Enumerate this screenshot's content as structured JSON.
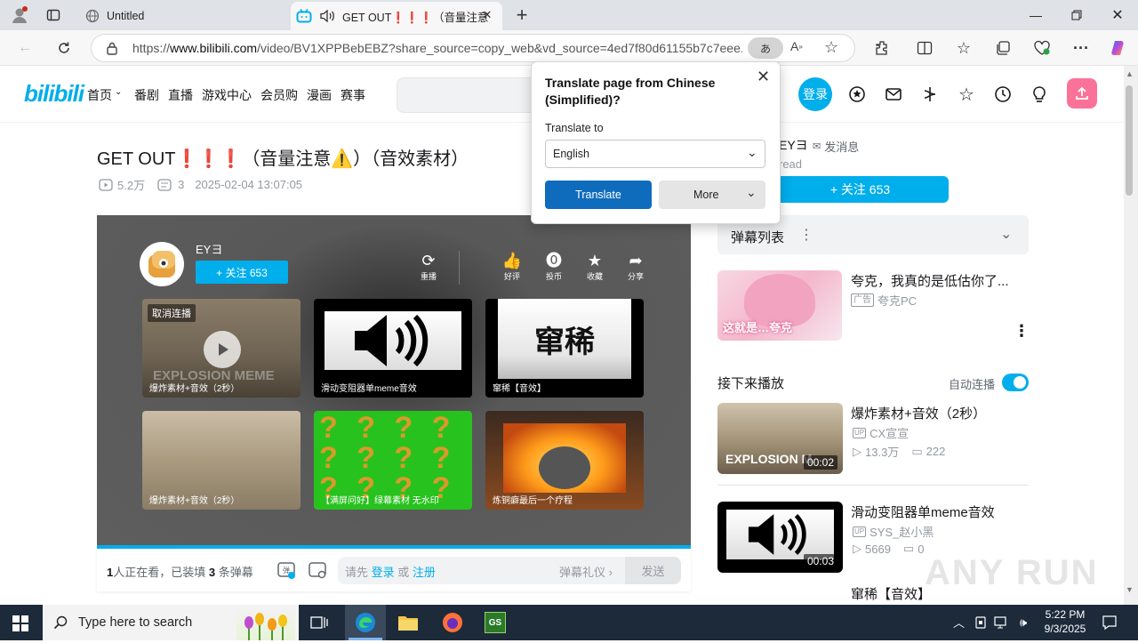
{
  "browser": {
    "tabs": [
      {
        "title": "Untitled",
        "active": false
      },
      {
        "title": "GET OUT❗❗❗（音量注意⚠️）",
        "active": true
      }
    ],
    "url_prefix": "https://",
    "url_host": "www.bilibili.com",
    "url_rest": "/video/BV1XPPBebEBZ?share_source=copy_web&vd_source=4ed7f80d61155b7c7eee...",
    "translate_icon_label": "あ"
  },
  "translate_popup": {
    "heading": "Translate page from Chinese (Simplified)?",
    "label": "Translate to",
    "language": "English",
    "translate_button": "Translate",
    "more_button": "More"
  },
  "site": {
    "logo": "bilibili",
    "nav": [
      "首页",
      "番剧",
      "直播",
      "游戏中心",
      "会员购",
      "漫画",
      "赛事"
    ],
    "login": "登录"
  },
  "video": {
    "title": "GET OUT❗❗❗（音量注意⚠️）（音效素材）",
    "views": "5.2万",
    "danmaku_count": "3",
    "date": "2025-02-04 13:07:05"
  },
  "endscreen": {
    "uploader": "EYヨ",
    "follow": "+ 关注 653",
    "replay": "重播",
    "actions": [
      "好评",
      "投币",
      "收藏",
      "分享"
    ],
    "cancel_autoplay": "取消连播",
    "items": [
      {
        "caption": "爆炸素材+音效（2秒）",
        "art": "EXPLOSION MEME"
      },
      {
        "caption": "滑动变阻器单meme音效",
        "art": ""
      },
      {
        "caption": "窜稀【音效】",
        "art": "窜稀"
      },
      {
        "caption": "爆炸素材+音效（2秒）",
        "art": ""
      },
      {
        "caption": "【满屏问好】绿幕素材 无水印",
        "art": "?"
      },
      {
        "caption": "炼铜癖最后一个疗程",
        "art": ""
      }
    ]
  },
  "danmaku_bar": {
    "watching_num": "1",
    "watching_text": "人正在看，已装填",
    "loaded_num": "3",
    "loaded_text": "条弹幕",
    "prompt": "请先",
    "login_link": "登录",
    "or": "或",
    "register_link": "注册",
    "etiquette": "弹幕礼仪 ›",
    "send": "发送"
  },
  "sidebar": {
    "uploader_name": "EYヨ",
    "message": "发消息",
    "uploader_desc": "read",
    "follow": "+ 关注 653",
    "danmaku_list": "弹幕列表",
    "ad": {
      "title": "夸克，我真的是低估你了...",
      "badge": "广告",
      "source": "夸克PC",
      "thumb_text": "这就是…夸克"
    },
    "next_play": "接下来播放",
    "autoplay": "自动连播",
    "recommendations": [
      {
        "title": "爆炸素材+音效（2秒）",
        "uploader": "CX宣宣",
        "views": "13.3万",
        "danmaku": "222",
        "duration": "00:02",
        "thumb_text": "EXPLOSION M"
      },
      {
        "title": "滑动变阻器单meme音效",
        "uploader": "SYS_赵小黑",
        "views": "5669",
        "danmaku": "0",
        "duration": "00:03"
      },
      {
        "title": "窜稀【音效】"
      }
    ]
  },
  "watermark": "ANY RUN",
  "taskbar": {
    "search_placeholder": "Type here to search",
    "time": "5:22 PM",
    "date": "9/3/2025"
  },
  "colors": {
    "accent": "#00aeec",
    "pink": "#fb7299",
    "edge_blue": "#0f6cbd"
  }
}
